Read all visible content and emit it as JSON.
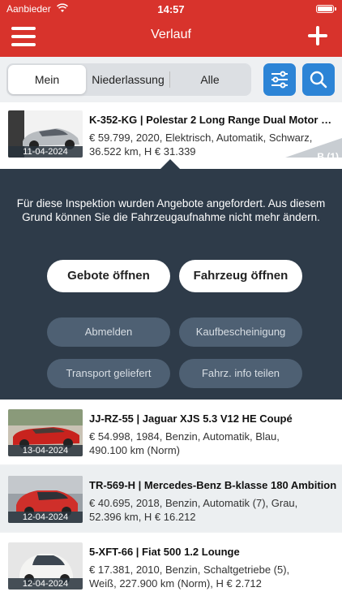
{
  "status": {
    "carrier": "Aanbieder",
    "time": "14:57"
  },
  "nav": {
    "title": "Verlauf"
  },
  "tabs": [
    {
      "label": "Mein"
    },
    {
      "label": "Niederlassung"
    },
    {
      "label": "Alle"
    }
  ],
  "items": [
    {
      "date": "11-04-2024",
      "title": "K-352-KG | Polestar 2 Long Range Dual Motor La...",
      "line1": "€ 59.799, 2020, Elektrisch, Automatik, Schwarz,",
      "line2": "36.522 km, H € 31.339",
      "badge": "B (1)"
    },
    {
      "date": "13-04-2024",
      "title": "JJ-RZ-55 | Jaguar XJS 5.3 V12 HE Coupé",
      "line1": "€ 54.998, 1984, Benzin, Automatik, Blau,",
      "line2": "490.100 km (Norm)"
    },
    {
      "date": "12-04-2024",
      "title": "TR-569-H | Mercedes-Benz B-klasse 180 Ambition",
      "line1": "€ 40.695, 2018, Benzin, Automatik (7), Grau,",
      "line2": "52.396 km, H € 16.212"
    },
    {
      "date": "12-04-2024",
      "title": "5-XFT-66 | Fiat 500 1.2 Lounge",
      "line1": "€ 17.381, 2010, Benzin, Schaltgetriebe (5),",
      "line2": "Weiß, 227.900 km (Norm), H € 2.712"
    }
  ],
  "panel": {
    "message": "Für diese Inspektion wurden Angebote angefordert. Aus diesem Grund können Sie die Fahrzeugaufnahme nicht mehr ändern.",
    "open_bids": "Gebote öffnen",
    "open_vehicle": "Fahrzeug öffnen",
    "unsubscribe": "Abmelden",
    "purchase_certificate": "Kaufbescheinigung",
    "transport_delivered": "Transport geliefert",
    "share_vehicle_info": "Fahrz. info teilen"
  },
  "colors": {
    "brand": "#d8332c",
    "accent": "#2c84d6",
    "panel": "#2e3b49"
  }
}
